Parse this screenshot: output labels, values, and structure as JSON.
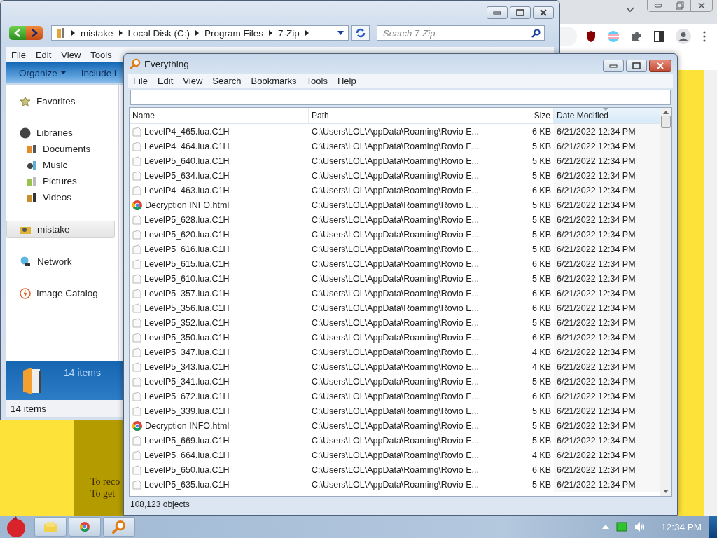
{
  "browser": {
    "page_texts": [
      "To reco",
      "To get"
    ]
  },
  "explorer": {
    "breadcrumb": [
      "mistake",
      "Local Disk (C:)",
      "Program Files",
      "7-Zip"
    ],
    "search": {
      "placeholder": "Search 7-Zip"
    },
    "menu": [
      "File",
      "Edit",
      "View",
      "Tools"
    ],
    "toolbar": [
      "Organize",
      "Include i"
    ],
    "sidebar": [
      {
        "label": "Favorites",
        "kind": "star",
        "selected": false
      },
      {
        "label": "Libraries",
        "kind": "library",
        "selected": false,
        "children": [
          {
            "label": "Documents",
            "kind": "documents",
            "selected": false
          },
          {
            "label": "Music",
            "kind": "music",
            "selected": false
          },
          {
            "label": "Pictures",
            "kind": "pictures",
            "selected": false
          },
          {
            "label": "Videos",
            "kind": "videos",
            "selected": false
          }
        ]
      },
      {
        "label": "mistake",
        "kind": "user",
        "selected": true
      },
      {
        "label": "Network",
        "kind": "network",
        "selected": false
      },
      {
        "label": "Image Catalog",
        "kind": "catalog",
        "selected": false
      }
    ],
    "details": "14 items",
    "status_bar": "14 items"
  },
  "everything": {
    "window": {
      "title": "Everything"
    },
    "menu": [
      "File",
      "Edit",
      "View",
      "Search",
      "Bookmarks",
      "Tools",
      "Help"
    ],
    "columns": [
      {
        "label": "Name",
        "sorted": false
      },
      {
        "label": "Path",
        "sorted": false
      },
      {
        "label": "Size",
        "sorted": false
      },
      {
        "label": "Date Modified",
        "sorted": true
      }
    ],
    "rows": [
      {
        "kind": "file",
        "name": "LevelP4_465.lua.C1H",
        "path": "C:\\Users\\LOL\\AppData\\Roaming\\Rovio E...",
        "size": "6 KB",
        "date": "6/21/2022 12:34 PM"
      },
      {
        "kind": "file",
        "name": "LevelP4_464.lua.C1H",
        "path": "C:\\Users\\LOL\\AppData\\Roaming\\Rovio E...",
        "size": "5 KB",
        "date": "6/21/2022 12:34 PM"
      },
      {
        "kind": "file",
        "name": "LevelP5_640.lua.C1H",
        "path": "C:\\Users\\LOL\\AppData\\Roaming\\Rovio E...",
        "size": "5 KB",
        "date": "6/21/2022 12:34 PM"
      },
      {
        "kind": "file",
        "name": "LevelP5_634.lua.C1H",
        "path": "C:\\Users\\LOL\\AppData\\Roaming\\Rovio E...",
        "size": "5 KB",
        "date": "6/21/2022 12:34 PM"
      },
      {
        "kind": "file",
        "name": "LevelP4_463.lua.C1H",
        "path": "C:\\Users\\LOL\\AppData\\Roaming\\Rovio E...",
        "size": "6 KB",
        "date": "6/21/2022 12:34 PM"
      },
      {
        "kind": "html",
        "name": "Decryption INFO.html",
        "path": "C:\\Users\\LOL\\AppData\\Roaming\\Rovio E...",
        "size": "5 KB",
        "date": "6/21/2022 12:34 PM"
      },
      {
        "kind": "file",
        "name": "LevelP5_628.lua.C1H",
        "path": "C:\\Users\\LOL\\AppData\\Roaming\\Rovio E...",
        "size": "5 KB",
        "date": "6/21/2022 12:34 PM"
      },
      {
        "kind": "file",
        "name": "LevelP5_620.lua.C1H",
        "path": "C:\\Users\\LOL\\AppData\\Roaming\\Rovio E...",
        "size": "5 KB",
        "date": "6/21/2022 12:34 PM"
      },
      {
        "kind": "file",
        "name": "LevelP5_616.lua.C1H",
        "path": "C:\\Users\\LOL\\AppData\\Roaming\\Rovio E...",
        "size": "5 KB",
        "date": "6/21/2022 12:34 PM"
      },
      {
        "kind": "file",
        "name": "LevelP5_615.lua.C1H",
        "path": "C:\\Users\\LOL\\AppData\\Roaming\\Rovio E...",
        "size": "6 KB",
        "date": "6/21/2022 12:34 PM"
      },
      {
        "kind": "file",
        "name": "LevelP5_610.lua.C1H",
        "path": "C:\\Users\\LOL\\AppData\\Roaming\\Rovio E...",
        "size": "5 KB",
        "date": "6/21/2022 12:34 PM"
      },
      {
        "kind": "file",
        "name": "LevelP5_357.lua.C1H",
        "path": "C:\\Users\\LOL\\AppData\\Roaming\\Rovio E...",
        "size": "6 KB",
        "date": "6/21/2022 12:34 PM"
      },
      {
        "kind": "file",
        "name": "LevelP5_356.lua.C1H",
        "path": "C:\\Users\\LOL\\AppData\\Roaming\\Rovio E...",
        "size": "6 KB",
        "date": "6/21/2022 12:34 PM"
      },
      {
        "kind": "file",
        "name": "LevelP5_352.lua.C1H",
        "path": "C:\\Users\\LOL\\AppData\\Roaming\\Rovio E...",
        "size": "5 KB",
        "date": "6/21/2022 12:34 PM"
      },
      {
        "kind": "file",
        "name": "LevelP5_350.lua.C1H",
        "path": "C:\\Users\\LOL\\AppData\\Roaming\\Rovio E...",
        "size": "6 KB",
        "date": "6/21/2022 12:34 PM"
      },
      {
        "kind": "file",
        "name": "LevelP5_347.lua.C1H",
        "path": "C:\\Users\\LOL\\AppData\\Roaming\\Rovio E...",
        "size": "4 KB",
        "date": "6/21/2022 12:34 PM"
      },
      {
        "kind": "file",
        "name": "LevelP5_343.lua.C1H",
        "path": "C:\\Users\\LOL\\AppData\\Roaming\\Rovio E...",
        "size": "4 KB",
        "date": "6/21/2022 12:34 PM"
      },
      {
        "kind": "file",
        "name": "LevelP5_341.lua.C1H",
        "path": "C:\\Users\\LOL\\AppData\\Roaming\\Rovio E...",
        "size": "5 KB",
        "date": "6/21/2022 12:34 PM"
      },
      {
        "kind": "file",
        "name": "LevelP5_672.lua.C1H",
        "path": "C:\\Users\\LOL\\AppData\\Roaming\\Rovio E...",
        "size": "6 KB",
        "date": "6/21/2022 12:34 PM"
      },
      {
        "kind": "file",
        "name": "LevelP5_339.lua.C1H",
        "path": "C:\\Users\\LOL\\AppData\\Roaming\\Rovio E...",
        "size": "5 KB",
        "date": "6/21/2022 12:34 PM"
      },
      {
        "kind": "html",
        "name": "Decryption INFO.html",
        "path": "C:\\Users\\LOL\\AppData\\Roaming\\Rovio E...",
        "size": "5 KB",
        "date": "6/21/2022 12:34 PM"
      },
      {
        "kind": "file",
        "name": "LevelP5_669.lua.C1H",
        "path": "C:\\Users\\LOL\\AppData\\Roaming\\Rovio E...",
        "size": "5 KB",
        "date": "6/21/2022 12:34 PM"
      },
      {
        "kind": "file",
        "name": "LevelP5_664.lua.C1H",
        "path": "C:\\Users\\LOL\\AppData\\Roaming\\Rovio E...",
        "size": "4 KB",
        "date": "6/21/2022 12:34 PM"
      },
      {
        "kind": "file",
        "name": "LevelP5_650.lua.C1H",
        "path": "C:\\Users\\LOL\\AppData\\Roaming\\Rovio E...",
        "size": "6 KB",
        "date": "6/21/2022 12:34 PM"
      },
      {
        "kind": "file",
        "name": "LevelP5_635.lua.C1H",
        "path": "C:\\Users\\LOL\\AppData\\Roaming\\Rovio E...",
        "size": "5 KB",
        "date": "6/21/2022 12:34 PM"
      }
    ],
    "status_bar": "108,123 objects"
  },
  "taskbar": {
    "clock": "12:34 PM"
  }
}
